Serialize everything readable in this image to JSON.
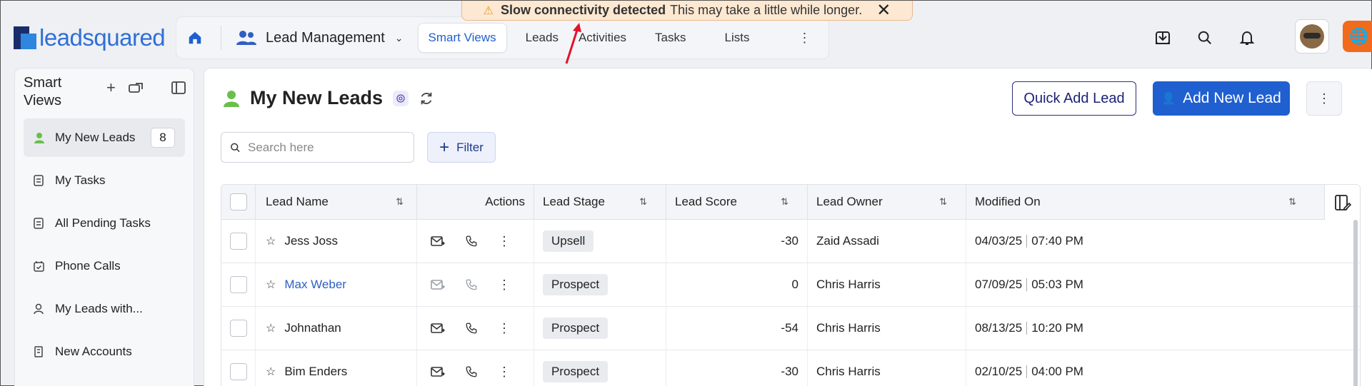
{
  "toast": {
    "bold": "Slow connectivity detected",
    "text": "This may take a little while longer."
  },
  "logo": {
    "text": "leadsquared"
  },
  "nav": {
    "module": "Lead Management",
    "tabs": [
      "Smart Views",
      "Leads",
      "Activities",
      "Tasks",
      "Lists"
    ],
    "more": "⋮"
  },
  "sidebar": {
    "title_line1": "Smart",
    "title_line2": "Views",
    "items": [
      {
        "label": "My New Leads",
        "count": "8",
        "icon": "person-icon"
      },
      {
        "label": "My Tasks",
        "icon": "task-icon"
      },
      {
        "label": "All Pending Tasks",
        "icon": "task-icon"
      },
      {
        "label": "Phone Calls",
        "icon": "calendar-icon"
      },
      {
        "label": "My Leads with...",
        "icon": "person-outline-icon"
      },
      {
        "label": "New Accounts",
        "icon": "building-icon"
      }
    ]
  },
  "main": {
    "title": "My New Leads",
    "quick_add": "Quick Add Lead",
    "add_new": "Add New Lead",
    "search_placeholder": "Search here",
    "filter": "Filter"
  },
  "table": {
    "headers": {
      "name": "Lead Name",
      "actions": "Actions",
      "stage": "Lead Stage",
      "score": "Lead Score",
      "owner": "Lead Owner",
      "modified": "Modified On"
    },
    "rows": [
      {
        "name": "Jess Joss",
        "stage": "Upsell",
        "score": "-30",
        "owner": "Zaid Assadi",
        "date": "04/03/25",
        "time": "07:40 PM",
        "link": false
      },
      {
        "name": "Max Weber",
        "stage": "Prospect",
        "score": "0",
        "owner": "Chris Harris",
        "date": "07/09/25",
        "time": "05:03 PM",
        "link": true
      },
      {
        "name": "Johnathan",
        "stage": "Prospect",
        "score": "-54",
        "owner": "Chris Harris",
        "date": "08/13/25",
        "time": "10:20 PM",
        "link": false
      },
      {
        "name": "Bim Enders",
        "stage": "Prospect",
        "score": "-30",
        "owner": "Chris Harris",
        "date": "02/10/25",
        "time": "04:00 PM",
        "link": false
      }
    ]
  },
  "colors": {
    "primary": "#1f5fd0",
    "accent_orange": "#f26a1b",
    "toast_bg": "#fde8d2"
  }
}
